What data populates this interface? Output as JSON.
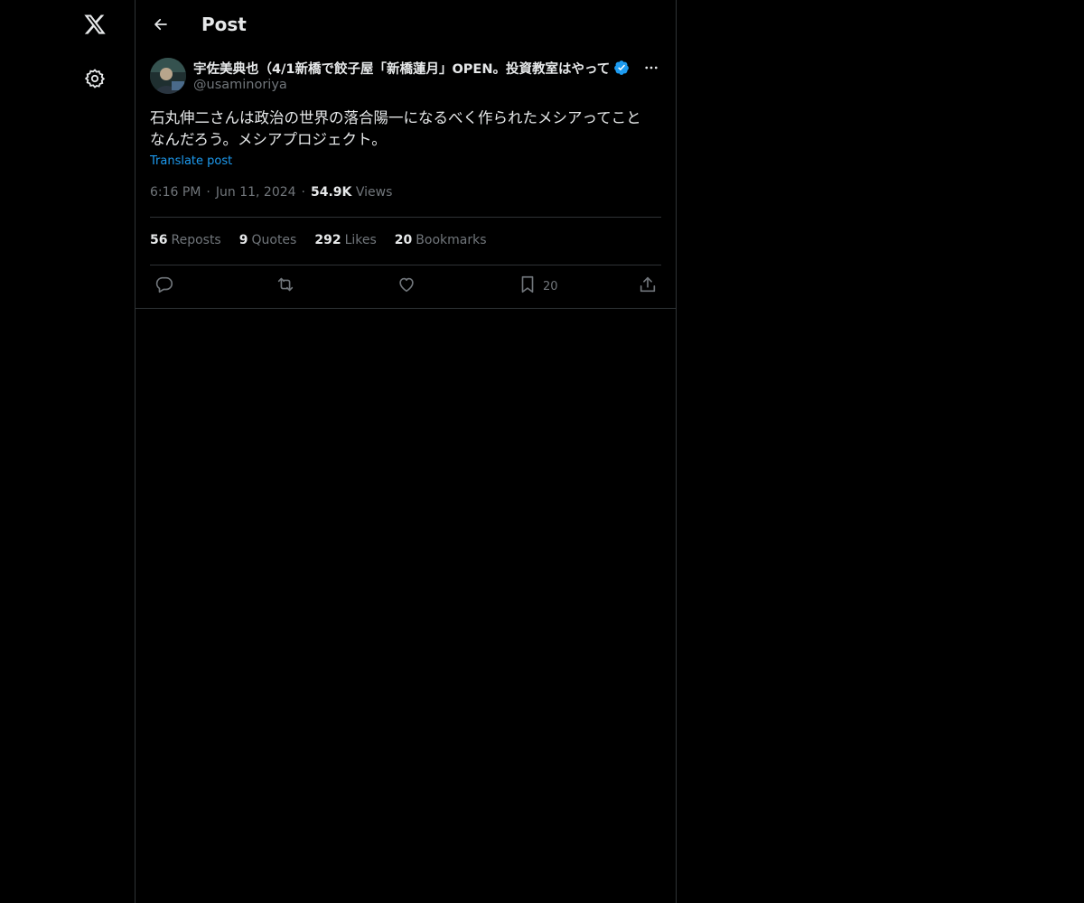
{
  "header": {
    "title": "Post"
  },
  "post": {
    "display_name": "宇佐美典也（4/1新橋で餃子屋「新橋蓮月」OPEN。投資教室はやって",
    "handle": "@usaminoriya",
    "text": "石丸伸二さんは政治の世界の落合陽一になるべく作られたメシアってこと\nなんだろう。メシアプロジェクト。",
    "translate_label": "Translate post",
    "time": "6:16 PM",
    "date": "Jun 11, 2024",
    "views_count": "54.9K",
    "views_label": "Views",
    "stats": [
      {
        "count": "56",
        "label": "Reposts"
      },
      {
        "count": "9",
        "label": "Quotes"
      },
      {
        "count": "292",
        "label": "Likes"
      },
      {
        "count": "20",
        "label": "Bookmarks"
      }
    ],
    "bookmark_count": "20"
  },
  "colors": {
    "background": "#000000",
    "text": "#e7e9ea",
    "secondary": "#71767b",
    "accent": "#1d9bf0",
    "border": "#2f3336"
  },
  "icons": [
    "x-logo-icon",
    "settings-gear-icon",
    "back-arrow-icon",
    "verified-badge-icon",
    "more-icon",
    "reply-icon",
    "repost-icon",
    "like-icon",
    "bookmark-icon",
    "share-icon"
  ]
}
